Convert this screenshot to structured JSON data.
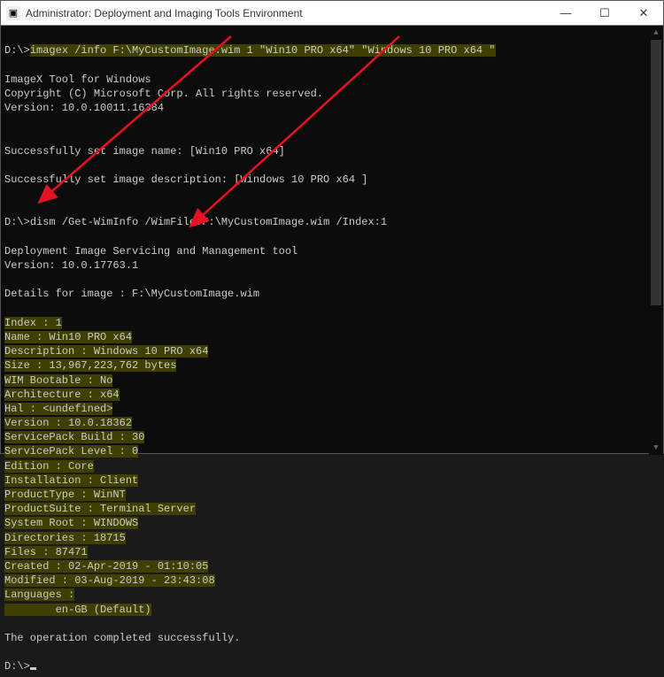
{
  "window": {
    "title": "Administrator: Deployment and Imaging Tools Environment"
  },
  "lines": {
    "p1": "D:\\>",
    "cmd1": "imagex /info F:\\MyCustomImage.wim 1 \"Win10 PRO x64\" \"Windows 10 PRO x64 \"",
    "t1": "ImageX Tool for Windows",
    "t2": "Copyright (C) Microsoft Corp. All rights reserved.",
    "t3": "Version: 10.0.10011.16384",
    "s1": "Successfully set image name: [Win10 PRO x64]",
    "s2": "Successfully set image description: [Windows 10 PRO x64 ]",
    "p2": "D:\\>",
    "cmd2": "dism /Get-WimInfo /WimFile:F:\\MyCustomImage.wim /Index:1",
    "d1": "Deployment Image Servicing and Management tool",
    "d2": "Version: 10.0.17763.1",
    "d3": "Details for image : F:\\MyCustomImage.wim",
    "i1": "Index : 1",
    "i2": "Name : Win10 PRO x64",
    "i3": "Description : Windows 10 PRO x64",
    "i4": "Size : 13,967,223,762 bytes",
    "i5": "WIM Bootable : No",
    "i6": "Architecture : x64",
    "i7": "Hal : <undefined>",
    "i8": "Version : 10.0.18362",
    "i9": "ServicePack Build : 30",
    "i10": "ServicePack Level : 0",
    "i11": "Edition : Core",
    "i12": "Installation : Client",
    "i13": "ProductType : WinNT",
    "i14": "ProductSuite : Terminal Server",
    "i15": "System Root : WINDOWS",
    "i16": "Directories : 18715",
    "i17": "Files : 87471",
    "i18": "Created : 02-Apr-2019 - 01:10:05",
    "i19": "Modified : 03-Aug-2019 - 23:43:08",
    "i20": "Languages :",
    "i21": "        en-GB (Default)",
    "ok": "The operation completed successfully.",
    "p3": "D:\\>"
  }
}
